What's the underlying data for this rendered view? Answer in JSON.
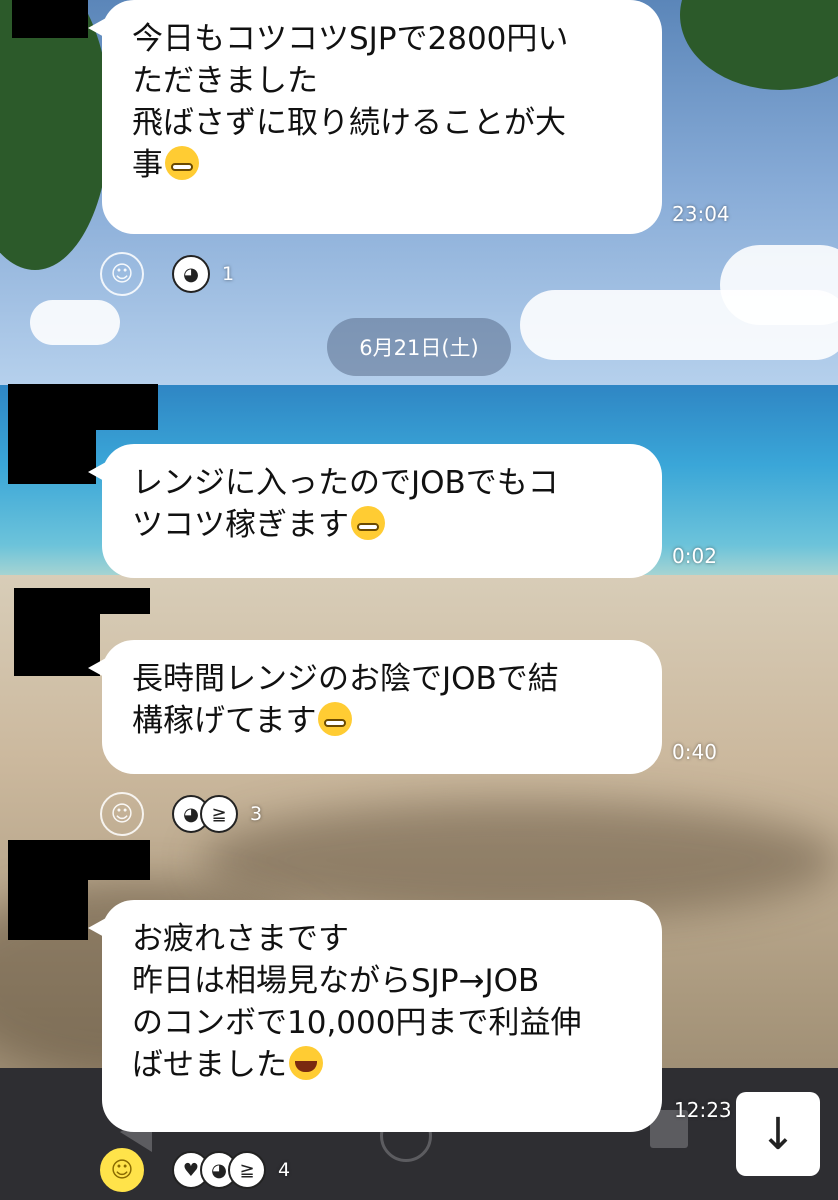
{
  "colors": {
    "bubble": "#ffffff",
    "redaction": "#000000",
    "reaction_active": "#ffe34a"
  },
  "date_separator": "6月21日(土)",
  "messages": [
    {
      "lines": [
        "今日もコツコツSJPで2800円い",
        "ただきました",
        "飛ばさずに取り続けることが大",
        "事"
      ],
      "emoji": "grinning-face-icon",
      "time": "23:04",
      "reactions": {
        "faces": [
          "thumbs-up-face-icon"
        ],
        "count": "1"
      }
    },
    {
      "lines": [
        "レンジに入ったのでJOBでもコ",
        "ツコツ稼ぎます"
      ],
      "emoji": "grinning-face-icon",
      "time": "0:02"
    },
    {
      "lines": [
        "長時間レンジのお陰でJOBで結",
        "構稼げてます"
      ],
      "emoji": "grinning-face-icon",
      "time": "0:40",
      "reactions": {
        "faces": [
          "thumbs-up-face-icon",
          "laughing-face-icon"
        ],
        "count": "3"
      }
    },
    {
      "lines": [
        "お疲れさまです",
        "昨日は相場見ながらSJP→JOB",
        "のコンボで10,000円まで利益伸",
        "ばせました"
      ],
      "emoji": "laughing-face-icon",
      "time": "12:23",
      "reactions": {
        "faces": [
          "heart-eyes-face-icon",
          "thumbs-up-face-icon",
          "laughing-face-icon"
        ],
        "count": "4"
      }
    }
  ],
  "icons": {
    "add_reaction": "smiley-icon",
    "scroll_down": "arrow-down-icon"
  }
}
